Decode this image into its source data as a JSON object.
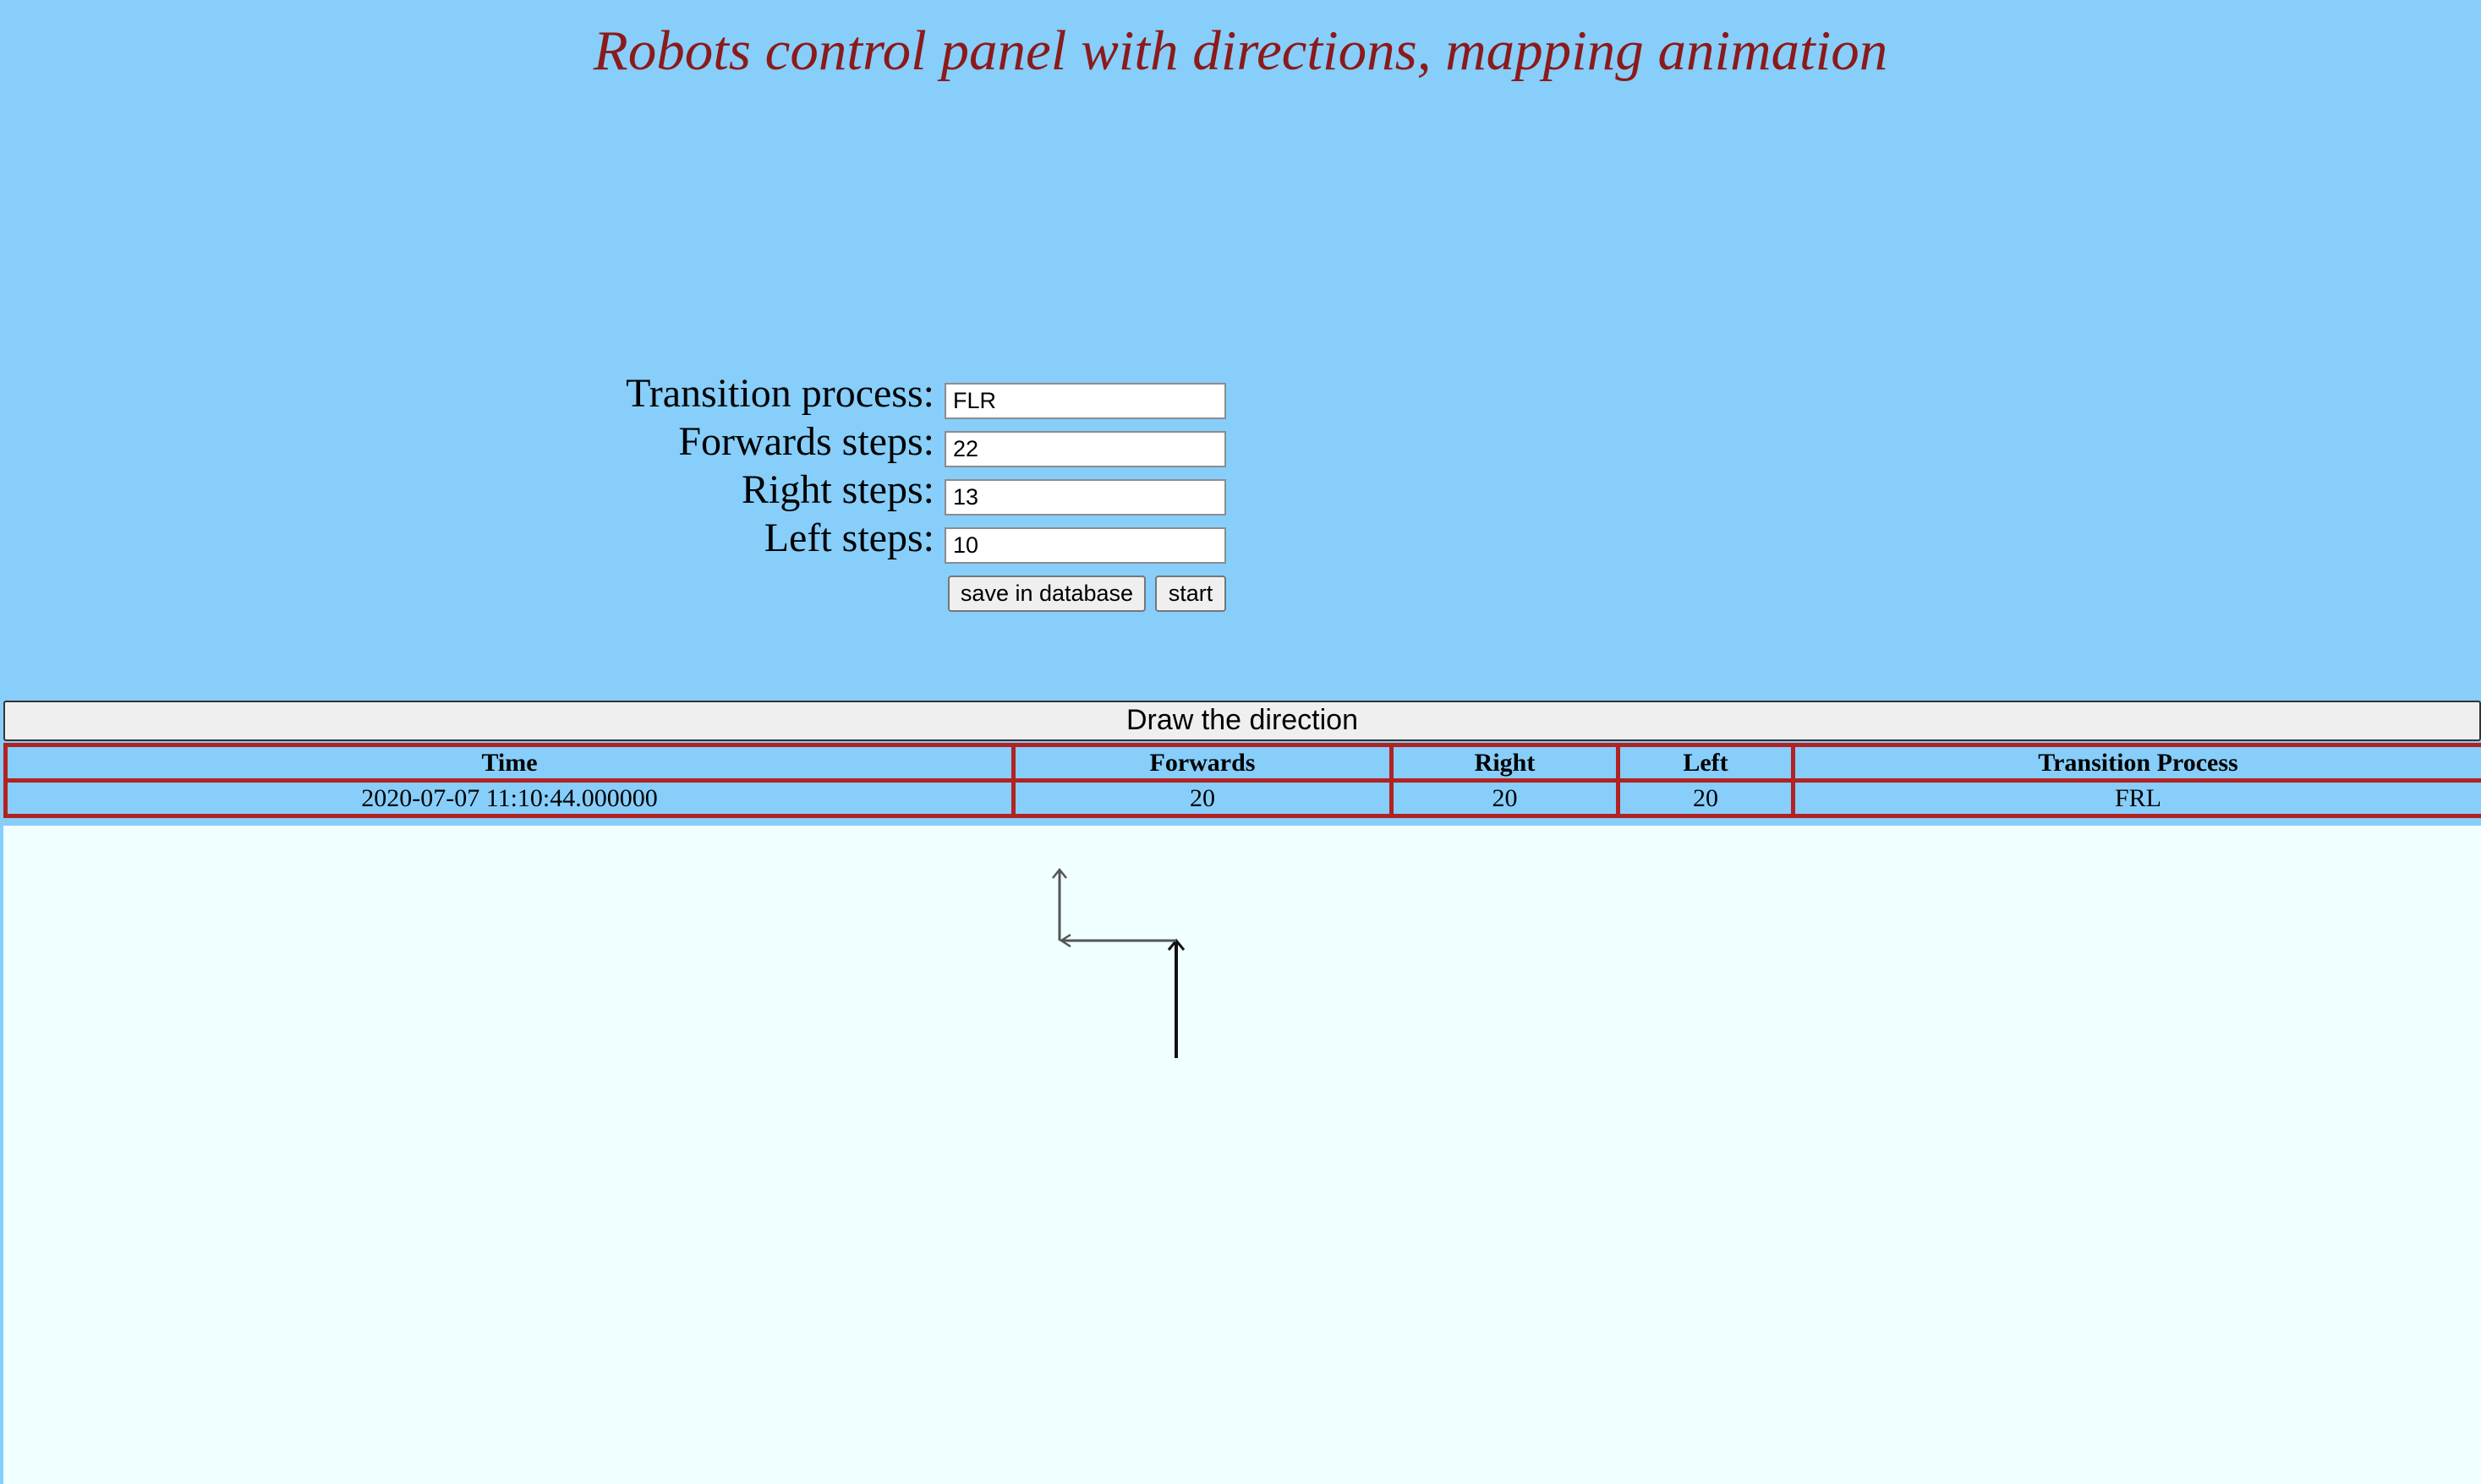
{
  "page": {
    "title": "Robots control panel with directions, mapping animation"
  },
  "form": {
    "transition_label": "Transition process:",
    "transition_value": "FLR",
    "forwards_label": "Forwards steps:",
    "forwards_value": "22",
    "right_label": "Right steps:",
    "right_value": "13",
    "left_label": "Left steps:",
    "left_value": "10",
    "save_button": "save in database",
    "start_button": "start"
  },
  "draw_button": "Draw the direction",
  "table": {
    "headers": [
      "Time",
      "Forwards",
      "Right",
      "Left",
      "Transition Process"
    ],
    "rows": [
      [
        "2020-07-07 11:10:44.000000",
        "20",
        "20",
        "20",
        "FRL"
      ]
    ]
  },
  "colors": {
    "background": "#87cefa",
    "canvas": "#f0ffff",
    "title": "#8b1a1a",
    "table_border": "#b22222"
  },
  "icons": [
    "up-arrow-icon",
    "left-arrow-icon",
    "up-arrow-icon"
  ]
}
